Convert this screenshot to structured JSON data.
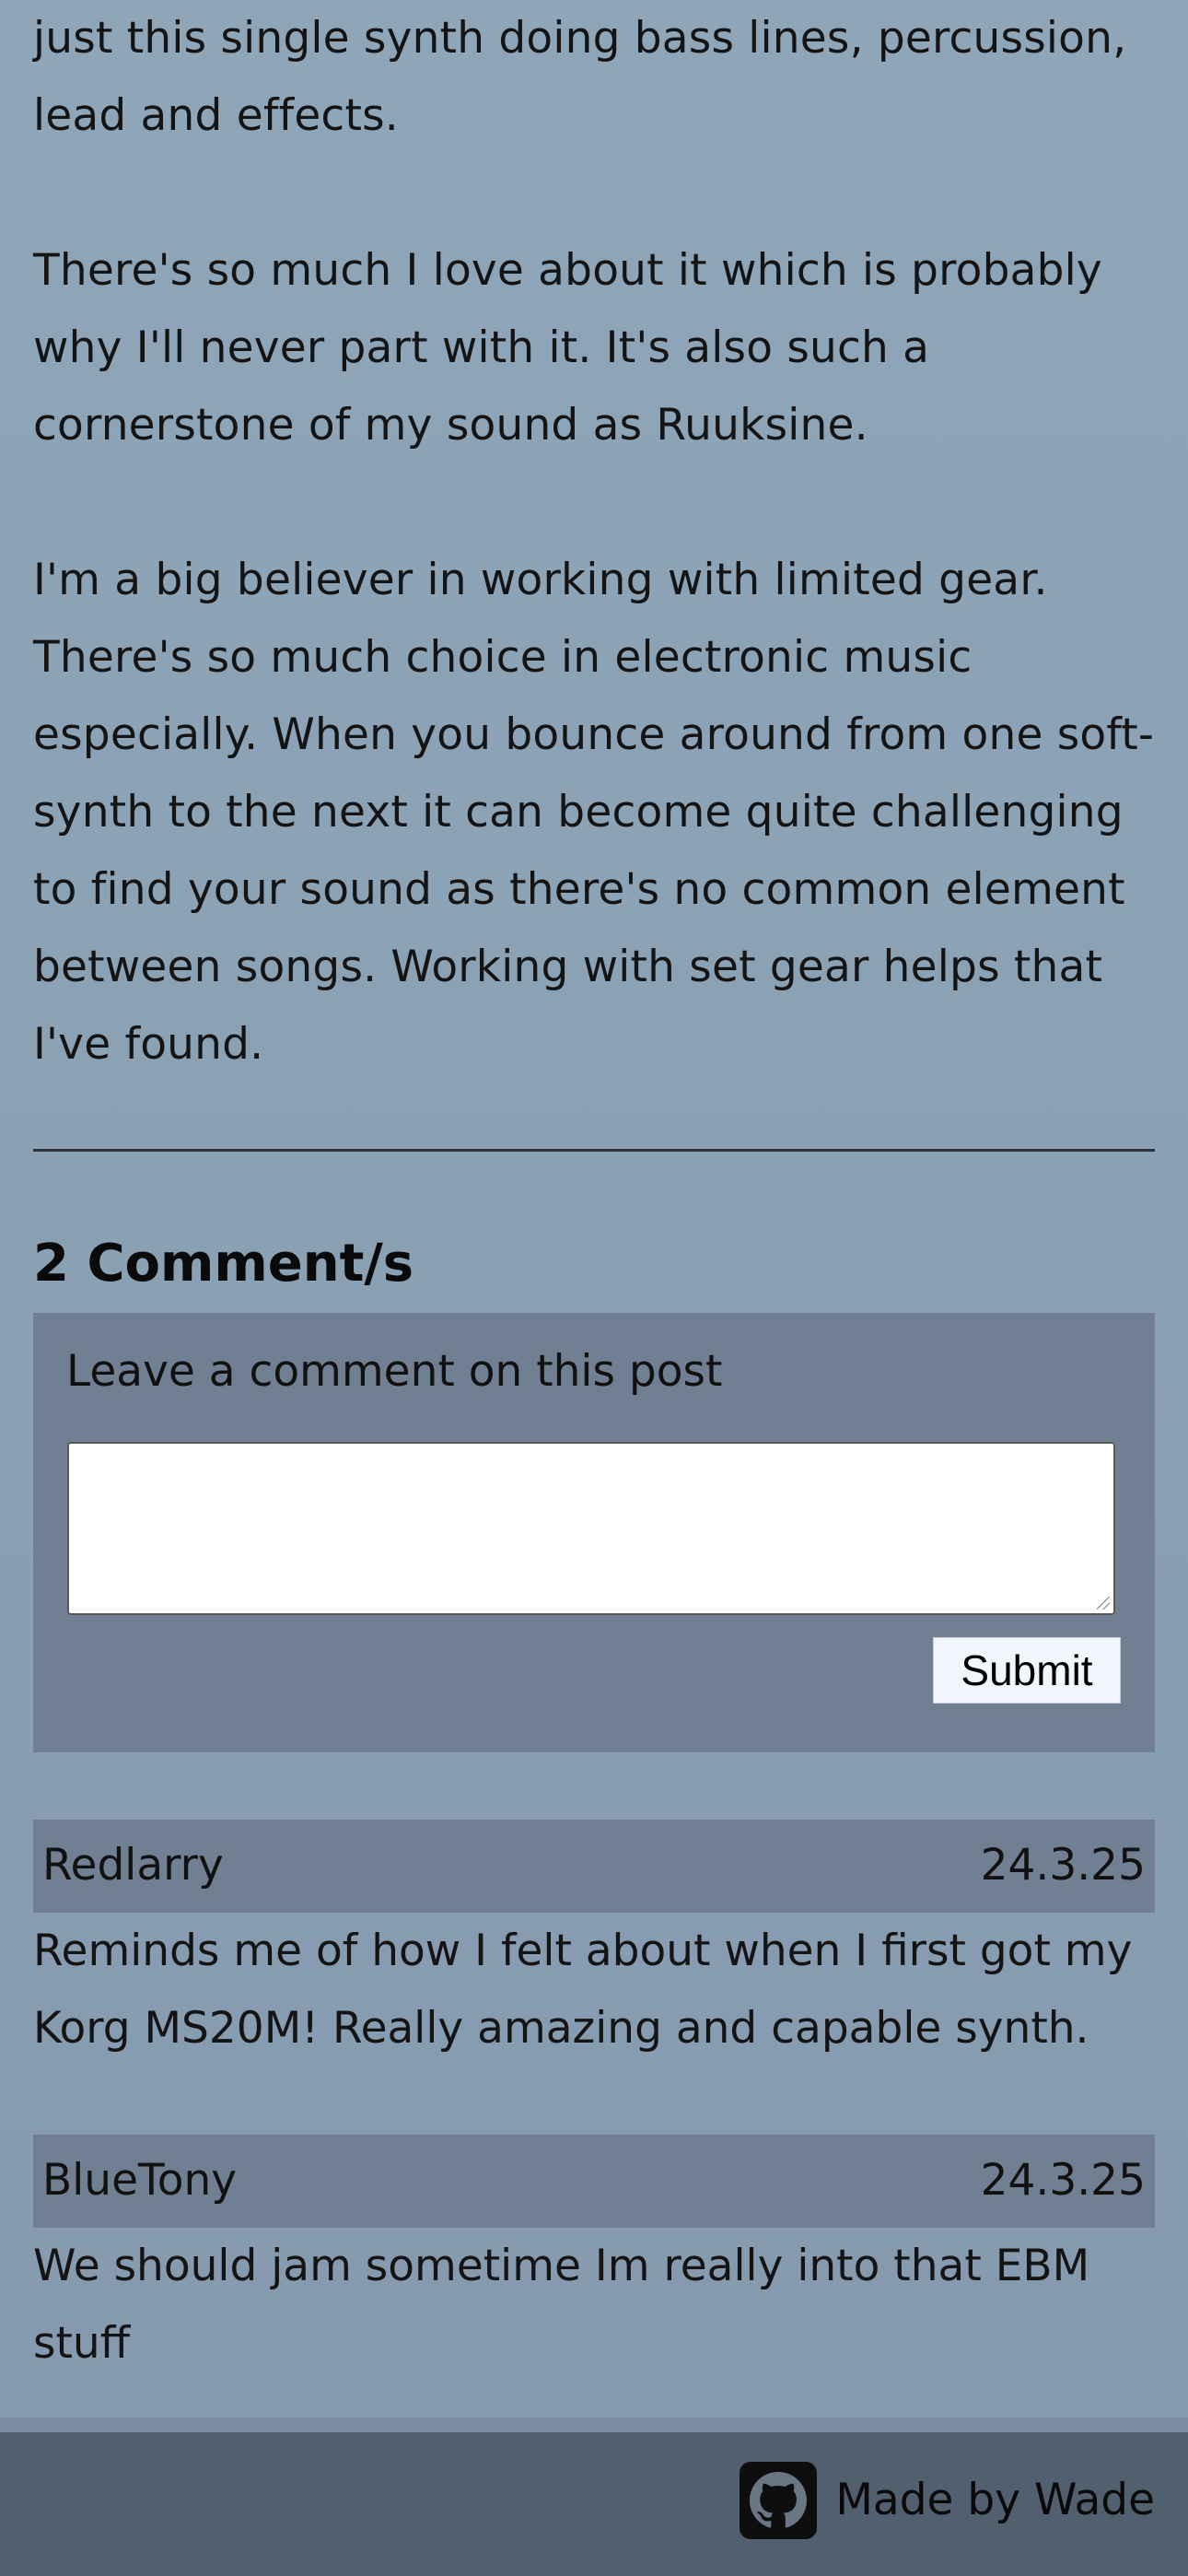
{
  "post": {
    "paragraphs": [
      "just this single synth doing bass lines, percussion, lead and effects.",
      "There's so much I love about it which is probably why I'll never part with it. It's also such a cornerstone of my sound as Ruuksine.",
      "I'm a big believer in working with limited gear. There's so much choice in electronic music especially. When you bounce around from one soft-synth to the next it can become quite challenging to find your sound as there's no common element between songs. Working with set gear helps that I've found."
    ]
  },
  "comments_section": {
    "heading": "2 Comment/s",
    "form": {
      "label": "Leave a comment on this post",
      "textarea_value": "",
      "submit_label": "Submit"
    },
    "comments": [
      {
        "author": "Redlarry",
        "date": "24.3.25",
        "body": "Reminds me of how I felt about when I first got my Korg MS20M! Really amazing and capable synth."
      },
      {
        "author": "BlueTony",
        "date": "24.3.25",
        "body": "We should jam sometime Im really into that EBM stuff"
      }
    ]
  },
  "footer": {
    "text": "Made by Wade",
    "icon": "github-icon"
  },
  "colors": {
    "background": "#8ca2b5",
    "panel": "#707f91",
    "footer": "#525f6e",
    "submit_button": "#f0f6fb"
  }
}
